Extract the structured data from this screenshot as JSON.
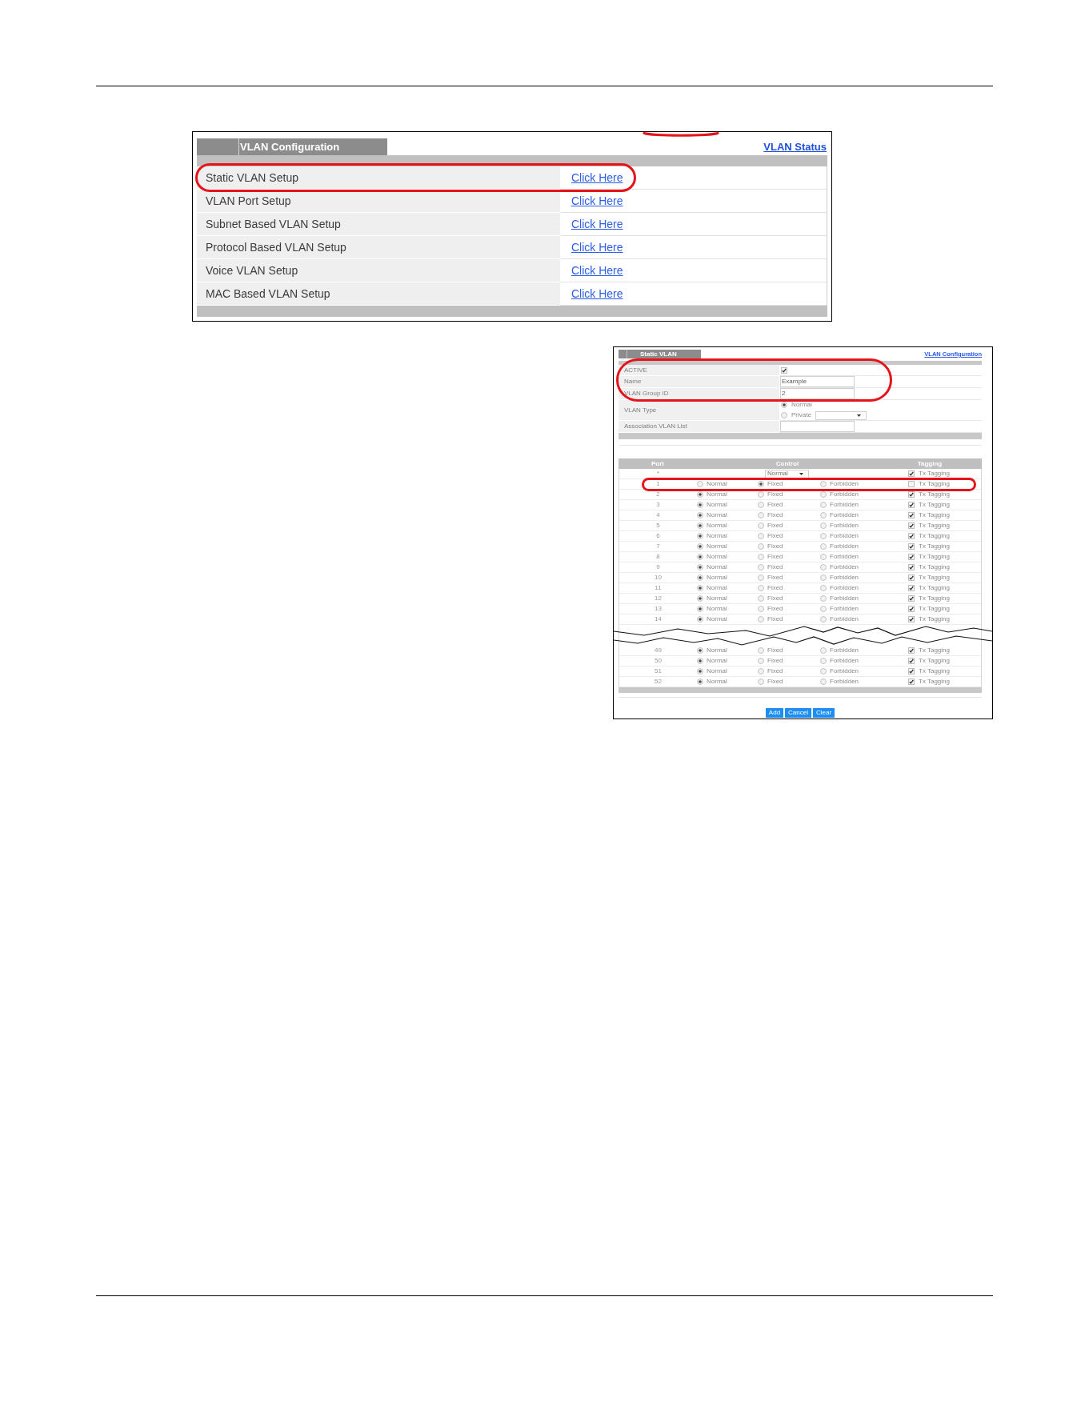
{
  "vlan_configuration": {
    "title": "VLAN Configuration",
    "link": "VLAN Status",
    "cut_off_highlight": true,
    "rows": [
      {
        "label": "Static VLAN Setup",
        "link": "Click Here",
        "highlighted": true
      },
      {
        "label": "VLAN Port Setup",
        "link": "Click Here",
        "highlighted": false
      },
      {
        "label": "Subnet Based VLAN Setup",
        "link": "Click Here",
        "highlighted": false
      },
      {
        "label": "Protocol Based VLAN Setup",
        "link": "Click Here",
        "highlighted": false
      },
      {
        "label": "Voice VLAN Setup",
        "link": "Click Here",
        "highlighted": false
      },
      {
        "label": "MAC Based VLAN Setup",
        "link": "Click Here",
        "highlighted": false
      }
    ]
  },
  "static_vlan": {
    "title": "Static VLAN",
    "link": "VLAN Configuration",
    "fields": [
      {
        "kind": "checkbox",
        "label": "ACTIVE",
        "checked": true,
        "highlighted": true
      },
      {
        "kind": "text",
        "label": "Name",
        "value": "Example",
        "highlighted": true
      },
      {
        "kind": "text",
        "label": "VLAN Group ID",
        "value": "2",
        "highlighted": true
      },
      {
        "kind": "radio_group",
        "label": "VLAN Type",
        "highlighted": false,
        "options": [
          {
            "label": "Normal",
            "selected": true
          },
          {
            "label": "Private",
            "selected": false,
            "dropdown": true
          }
        ]
      },
      {
        "kind": "text",
        "label": "Association VLAN List",
        "highlighted": false
      }
    ],
    "port_table": {
      "columns": [
        "Port",
        "Control",
        "Tagging"
      ],
      "rows": [
        {
          "kind": "all",
          "port": "*",
          "highlighted": false,
          "control": "Normal",
          "tagging": {
            "label": "Tx Tagging",
            "checked": true
          }
        },
        {
          "kind": "port",
          "port": "1",
          "highlighted": true,
          "options": [
            {
              "label": "Normal",
              "selected": false
            },
            {
              "label": "Fixed",
              "selected": true
            },
            {
              "label": "Forbidden",
              "selected": false
            }
          ],
          "tagging": {
            "label": "Tx Tagging",
            "checked": false
          }
        },
        {
          "kind": "port",
          "port": "2",
          "highlighted": false,
          "options": [
            {
              "label": "Normal",
              "selected": true
            },
            {
              "label": "Fixed",
              "selected": false
            },
            {
              "label": "Forbidden",
              "selected": false
            }
          ],
          "tagging": {
            "label": "Tx Tagging",
            "checked": true
          }
        },
        {
          "kind": "port",
          "port": "3",
          "highlighted": false,
          "options": [
            {
              "label": "Normal",
              "selected": true
            },
            {
              "label": "Fixed",
              "selected": false
            },
            {
              "label": "Forbidden",
              "selected": false
            }
          ],
          "tagging": {
            "label": "Tx Tagging",
            "checked": true
          }
        },
        {
          "kind": "port",
          "port": "4",
          "highlighted": false,
          "options": [
            {
              "label": "Normal",
              "selected": true
            },
            {
              "label": "Fixed",
              "selected": false
            },
            {
              "label": "Forbidden",
              "selected": false
            }
          ],
          "tagging": {
            "label": "Tx Tagging",
            "checked": true
          }
        },
        {
          "kind": "port",
          "port": "5",
          "highlighted": false,
          "options": [
            {
              "label": "Normal",
              "selected": true
            },
            {
              "label": "Fixed",
              "selected": false
            },
            {
              "label": "Forbidden",
              "selected": false
            }
          ],
          "tagging": {
            "label": "Tx Tagging",
            "checked": true
          }
        },
        {
          "kind": "port",
          "port": "6",
          "highlighted": false,
          "options": [
            {
              "label": "Normal",
              "selected": true
            },
            {
              "label": "Fixed",
              "selected": false
            },
            {
              "label": "Forbidden",
              "selected": false
            }
          ],
          "tagging": {
            "label": "Tx Tagging",
            "checked": true
          }
        },
        {
          "kind": "port",
          "port": "7",
          "highlighted": false,
          "options": [
            {
              "label": "Normal",
              "selected": true
            },
            {
              "label": "Fixed",
              "selected": false
            },
            {
              "label": "Forbidden",
              "selected": false
            }
          ],
          "tagging": {
            "label": "Tx Tagging",
            "checked": true
          }
        },
        {
          "kind": "port",
          "port": "8",
          "highlighted": false,
          "options": [
            {
              "label": "Normal",
              "selected": true
            },
            {
              "label": "Fixed",
              "selected": false
            },
            {
              "label": "Forbidden",
              "selected": false
            }
          ],
          "tagging": {
            "label": "Tx Tagging",
            "checked": true
          }
        },
        {
          "kind": "port",
          "port": "9",
          "highlighted": false,
          "options": [
            {
              "label": "Normal",
              "selected": true
            },
            {
              "label": "Fixed",
              "selected": false
            },
            {
              "label": "Forbidden",
              "selected": false
            }
          ],
          "tagging": {
            "label": "Tx Tagging",
            "checked": true
          }
        },
        {
          "kind": "port",
          "port": "10",
          "highlighted": false,
          "options": [
            {
              "label": "Normal",
              "selected": true
            },
            {
              "label": "Fixed",
              "selected": false
            },
            {
              "label": "Forbidden",
              "selected": false
            }
          ],
          "tagging": {
            "label": "Tx Tagging",
            "checked": true
          }
        },
        {
          "kind": "port",
          "port": "11",
          "highlighted": false,
          "options": [
            {
              "label": "Normal",
              "selected": true
            },
            {
              "label": "Fixed",
              "selected": false
            },
            {
              "label": "Forbidden",
              "selected": false
            }
          ],
          "tagging": {
            "label": "Tx Tagging",
            "checked": true
          }
        },
        {
          "kind": "port",
          "port": "12",
          "highlighted": false,
          "options": [
            {
              "label": "Normal",
              "selected": true
            },
            {
              "label": "Fixed",
              "selected": false
            },
            {
              "label": "Forbidden",
              "selected": false
            }
          ],
          "tagging": {
            "label": "Tx Tagging",
            "checked": true
          }
        },
        {
          "kind": "port",
          "port": "13",
          "highlighted": false,
          "options": [
            {
              "label": "Normal",
              "selected": true
            },
            {
              "label": "Fixed",
              "selected": false
            },
            {
              "label": "Forbidden",
              "selected": false
            }
          ],
          "tagging": {
            "label": "Tx Tagging",
            "checked": true
          }
        },
        {
          "kind": "port",
          "port": "14",
          "highlighted": false,
          "options": [
            {
              "label": "Normal",
              "selected": true
            },
            {
              "label": "Fixed",
              "selected": false
            },
            {
              "label": "Forbidden",
              "selected": false
            }
          ],
          "tagging": {
            "label": "Tx Tagging",
            "checked": true
          }
        },
        {
          "kind": "break"
        },
        {
          "kind": "port",
          "port": "49",
          "highlighted": false,
          "options": [
            {
              "label": "Normal",
              "selected": true
            },
            {
              "label": "Fixed",
              "selected": false
            },
            {
              "label": "Forbidden",
              "selected": false
            }
          ],
          "tagging": {
            "label": "Tx Tagging",
            "checked": true
          }
        },
        {
          "kind": "port",
          "port": "50",
          "highlighted": false,
          "options": [
            {
              "label": "Normal",
              "selected": true
            },
            {
              "label": "Fixed",
              "selected": false
            },
            {
              "label": "Forbidden",
              "selected": false
            }
          ],
          "tagging": {
            "label": "Tx Tagging",
            "checked": true
          }
        },
        {
          "kind": "port",
          "port": "51",
          "highlighted": false,
          "options": [
            {
              "label": "Normal",
              "selected": true
            },
            {
              "label": "Fixed",
              "selected": false
            },
            {
              "label": "Forbidden",
              "selected": false
            }
          ],
          "tagging": {
            "label": "Tx Tagging",
            "checked": true
          }
        },
        {
          "kind": "port",
          "port": "52",
          "highlighted": false,
          "options": [
            {
              "label": "Normal",
              "selected": true
            },
            {
              "label": "Fixed",
              "selected": false
            },
            {
              "label": "Forbidden",
              "selected": false
            }
          ],
          "tagging": {
            "label": "Tx Tagging",
            "checked": true
          }
        }
      ]
    },
    "buttons": [
      "Add",
      "Cancel",
      "Clear"
    ]
  }
}
